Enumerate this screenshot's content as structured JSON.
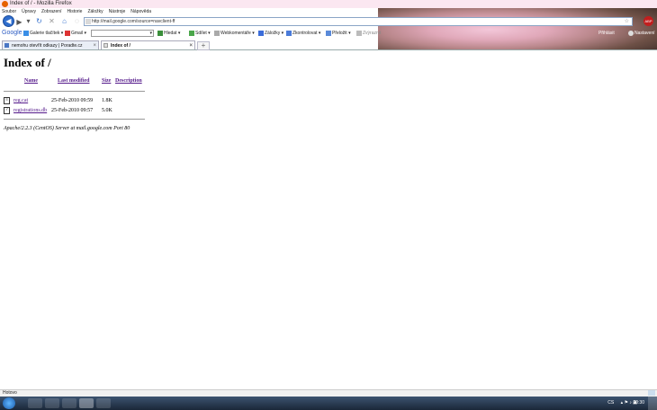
{
  "window": {
    "title": "Index of / - Mozilla Firefox"
  },
  "menu": [
    "Soubor",
    "Úpravy",
    "Zobrazení",
    "Historie",
    "Záložky",
    "Nástroje",
    "Nápověda"
  ],
  "nav": {
    "url": "http://mail.google.com/source=navclient-ff"
  },
  "google_toolbar": {
    "logo": "Google",
    "items": [
      "Galerie tlačítek",
      "Gmail",
      "Hledat",
      "Sdílet",
      "Webkomentáře",
      "Záložky",
      "Zkontrolovat",
      "Přeložit",
      "Zvýraznit"
    ],
    "right_items": [
      "Přihlásit",
      "Nastavení"
    ]
  },
  "tabs": [
    {
      "label": "nemohu otevřít odkazy | Poradte.cz",
      "active": false
    },
    {
      "label": "Index of /",
      "active": true
    }
  ],
  "page": {
    "title": "Index of /",
    "columns": [
      "Name",
      "Last modified",
      "Size",
      "Description"
    ],
    "files": [
      {
        "icon": "text-file-icon",
        "name": "reg.cat",
        "modified": "25-Feb-2010 09:59",
        "size": "1.8K",
        "description": ""
      },
      {
        "icon": "unknown-file-icon",
        "name": "registrations.db",
        "modified": "25-Feb-2010 09:57",
        "size": "5.0K",
        "description": ""
      }
    ],
    "footer": "Apache/2.2.3 (CentOS) Server at mail.google.com Port 80"
  },
  "status": {
    "text": "Hotovo"
  },
  "taskbar": {
    "lang": "CS",
    "clock": "20:30"
  }
}
